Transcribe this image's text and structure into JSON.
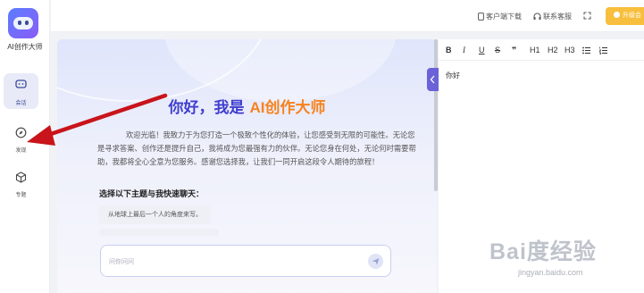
{
  "sidebar": {
    "brand": "AI创作大师",
    "items": [
      {
        "label": "会话",
        "icon": "chat-bubble-icon"
      },
      {
        "label": "发现",
        "icon": "compass-icon"
      },
      {
        "label": "专题",
        "icon": "cube-icon"
      }
    ]
  },
  "topbar": {
    "download": "客户端下载",
    "support": "联系客服",
    "upgrade": "升级会"
  },
  "chat": {
    "greeting_prefix": "你好，我是",
    "greeting_name": "AI创作大师",
    "intro": "欢迎光临！我致力于为您打造一个极致个性化的体验，让您感受到无限的可能性。无论您是寻求答案、创作还是提升自己，我将成为您最强有力的伙伴。无论您身在何处，无论何时需要帮助，我都将全心全意为您服务。感谢您选择我，让我们一同开启这段令人期待的旅程！",
    "topics_title": "选择以下主题与我快速聊天：",
    "suggestions": [
      "从地球上最后一个人的角度来写。"
    ],
    "input_placeholder": "问你问问"
  },
  "side_tab_label": "收起",
  "editor": {
    "tools": [
      "B",
      "I",
      "U",
      "S",
      "❞",
      "H1",
      "H2",
      "H3",
      "bullet-list-icon",
      "ordered-list-icon"
    ],
    "content": "你好"
  },
  "watermark": {
    "main": "Bai度经验",
    "sub": "jingyan.baidu.com"
  },
  "colors": {
    "accent": "#3f3dcf",
    "highlight": "#f7821d",
    "upgrade": "#f7bf3d",
    "arrow": "#c8141a"
  }
}
